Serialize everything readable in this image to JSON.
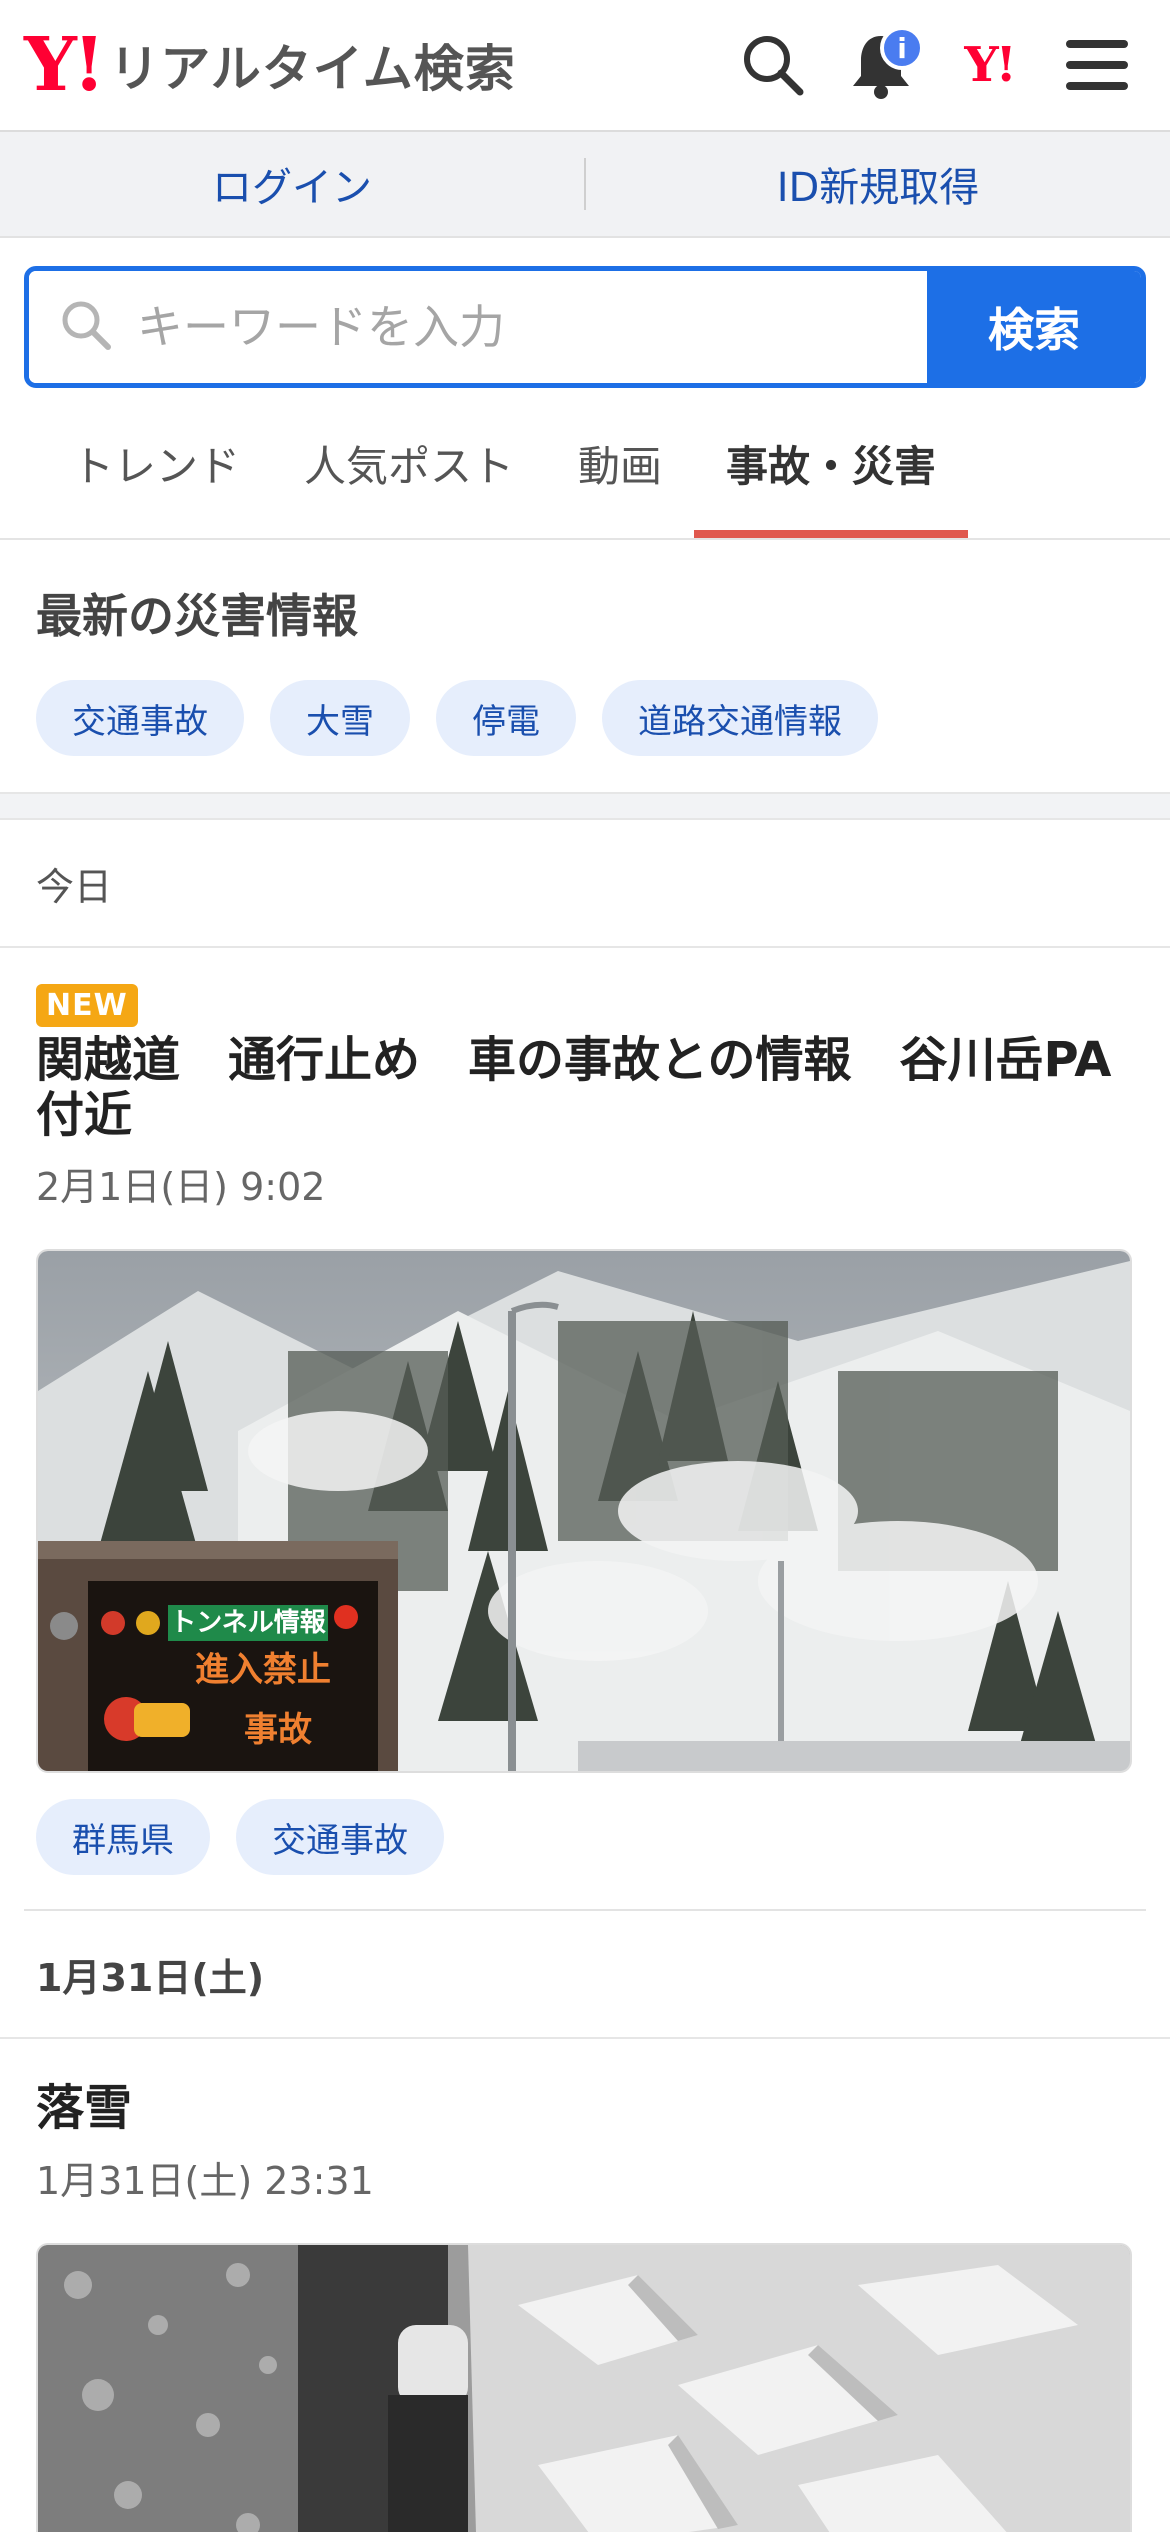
{
  "header": {
    "logo_mark": "Y!",
    "logo_text": "リアルタイム検索",
    "notification_badge": "i",
    "yahoo_mark": "Y!"
  },
  "loginbar": {
    "login": "ログイン",
    "register": "ID新規取得"
  },
  "search": {
    "placeholder": "キーワードを入力",
    "button": "検索"
  },
  "tabs": [
    {
      "label": "トレンド"
    },
    {
      "label": "人気ポスト"
    },
    {
      "label": "動画"
    },
    {
      "label": "事故・災害",
      "active": true
    }
  ],
  "disaster": {
    "title": "最新の災害情報",
    "chips": [
      "交通事故",
      "大雪",
      "停電",
      "道路交通情報"
    ]
  },
  "sections": [
    {
      "date": "今日",
      "articles": [
        {
          "badge": "NEW",
          "title": "関越道　通行止め　車の事故との情報　谷川岳PA付近",
          "time": "2月1日(日) 9:02",
          "image_sign_header": "トンネル情報",
          "image_sign_line1": "進入禁止",
          "image_sign_line2": "事故",
          "tags": [
            "群馬県",
            "交通事故"
          ]
        }
      ]
    },
    {
      "date": "1月31日(土)",
      "articles": [
        {
          "title": "落雪",
          "time": "1月31日(土) 23:31"
        }
      ]
    }
  ],
  "colors": {
    "brand_red": "#ff0033",
    "accent_blue": "#1d6fe6",
    "link_blue": "#1a4fae",
    "tab_underline": "#e0584e",
    "new_badge": "#f5a714"
  }
}
